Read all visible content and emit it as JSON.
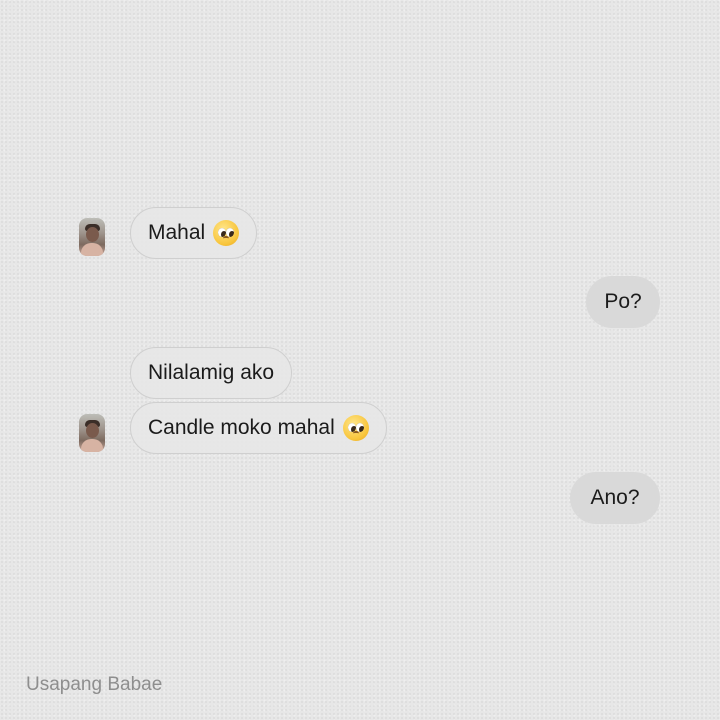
{
  "messages": [
    {
      "direction": "incoming",
      "text": "Mahal",
      "emoji": "pleading-face"
    },
    {
      "direction": "outgoing",
      "text": "Po?"
    },
    {
      "direction": "incoming",
      "text": "Nilalamig ako"
    },
    {
      "direction": "incoming",
      "text": "Candle moko mahal",
      "emoji": "pleading-face"
    },
    {
      "direction": "outgoing",
      "text": "Ano?"
    }
  ],
  "watermark": "Usapang Babae"
}
